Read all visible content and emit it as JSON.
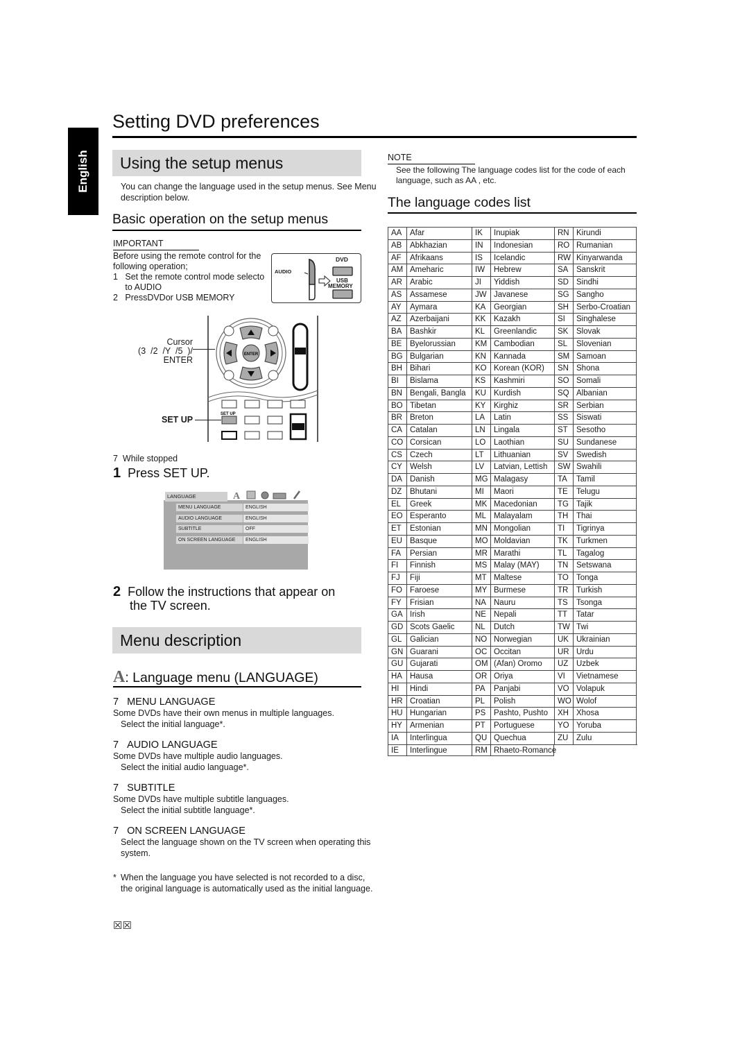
{
  "side_tab": {
    "label": "English"
  },
  "page_title": "Setting DVD preferences",
  "using_setup": {
    "heading": "Using the setup menus",
    "intro_line1": "You can change the language used in the setup menus. See  Menu",
    "intro_line2": "description  below.",
    "basic_heading": "Basic operation on the setup menus",
    "important_label": "IMPORTANT",
    "important_lines": [
      "Before using the remote control for the",
      "following operation;",
      "1   Set the remote control mode selecto",
      "     to AUDIO",
      "2   PressDVDor USB MEMORY"
    ],
    "mode_box": {
      "audio_label": "AUDIO",
      "dvd_label": "DVD",
      "usb_label_1": "USB",
      "usb_label_2": "MEMORY"
    },
    "remote": {
      "cursor_label_1": "Cursor",
      "cursor_label_2": "(3  /2  /Y  /5  )/",
      "cursor_label_3": "ENTER",
      "enter_button": "ENTER",
      "setup_button": "SET UP",
      "setup_callout": "SET UP"
    },
    "while_stopped": "7  While stopped",
    "step1": {
      "num": "1",
      "text": "Press SET UP."
    },
    "tv_screen": {
      "tab": "LANGUAGE",
      "rows": [
        {
          "key": "MENU LANGUAGE",
          "value": "ENGLISH"
        },
        {
          "key": "AUDIO LANGUAGE",
          "value": "ENGLISH"
        },
        {
          "key": "SUBTITLE",
          "value": "OFF"
        },
        {
          "key": "ON SCREEN LANGUAGE",
          "value": "ENGLISH"
        }
      ]
    },
    "step2": {
      "num": "2",
      "text_line1": "Follow the instructions that appear on",
      "text_line2": "the TV screen."
    }
  },
  "menu_description": {
    "heading": "Menu description",
    "language_menu_title": ": Language menu (LANGUAGE)",
    "items": [
      {
        "num": "7",
        "title": "MENU LANGUAGE",
        "line1": "Some DVDs have their own menus in multiple languages.",
        "line2": "Select the initial language*."
      },
      {
        "num": "7",
        "title": "AUDIO LANGUAGE",
        "line1": "Some DVDs have multiple audio languages.",
        "line2": "Select the initial audio language*."
      },
      {
        "num": "7",
        "title": "SUBTITLE",
        "line1": "Some DVDs have multiple subtitle languages.",
        "line2": "Select the initial subtitle language*."
      },
      {
        "num": "7",
        "title": "ON SCREEN LANGUAGE",
        "line1": "Select the language shown on the TV screen when operating this",
        "line2": "system."
      }
    ],
    "footnote_mark": "*",
    "footnote_line1": "When the language you have selected is not recorded to a disc,",
    "footnote_line2": "the original language is automatically used as the initial language."
  },
  "note": {
    "label": "NOTE",
    "line1": "See the following  The language codes list  for the code of each",
    "line2": "language, such as  AA , etc."
  },
  "codes": {
    "heading": "The language codes list",
    "rows": [
      [
        "AA",
        "Afar",
        "IK",
        "Inupiak",
        "RN",
        "Kirundi"
      ],
      [
        "AB",
        "Abkhazian",
        "IN",
        "Indonesian",
        "RO",
        "Rumanian"
      ],
      [
        "AF",
        "Afrikaans",
        "IS",
        "Icelandic",
        "RW",
        "Kinyarwanda"
      ],
      [
        "AM",
        "Ameharic",
        "IW",
        "Hebrew",
        "SA",
        "Sanskrit"
      ],
      [
        "AR",
        "Arabic",
        "JI",
        "Yiddish",
        "SD",
        "Sindhi"
      ],
      [
        "AS",
        "Assamese",
        "JW",
        "Javanese",
        "SG",
        "Sangho"
      ],
      [
        "AY",
        "Aymara",
        "KA",
        "Georgian",
        "SH",
        "Serbo-Croatian"
      ],
      [
        "AZ",
        "Azerbaijani",
        "KK",
        "Kazakh",
        "SI",
        "Singhalese"
      ],
      [
        "BA",
        "Bashkir",
        "KL",
        "Greenlandic",
        "SK",
        "Slovak"
      ],
      [
        "BE",
        "Byelorussian",
        "KM",
        "Cambodian",
        "SL",
        "Slovenian"
      ],
      [
        "BG",
        "Bulgarian",
        "KN",
        "Kannada",
        "SM",
        "Samoan"
      ],
      [
        "BH",
        "Bihari",
        "KO",
        "Korean (KOR)",
        "SN",
        "Shona"
      ],
      [
        "BI",
        "Bislama",
        "KS",
        "Kashmiri",
        "SO",
        "Somali"
      ],
      [
        "BN",
        "Bengali, Bangla",
        "KU",
        "Kurdish",
        "SQ",
        "Albanian"
      ],
      [
        "BO",
        "Tibetan",
        "KY",
        "Kirghiz",
        "SR",
        "Serbian"
      ],
      [
        "BR",
        "Breton",
        "LA",
        "Latin",
        "SS",
        "Siswati"
      ],
      [
        "CA",
        "Catalan",
        "LN",
        "Lingala",
        "ST",
        "Sesotho"
      ],
      [
        "CO",
        "Corsican",
        "LO",
        "Laothian",
        "SU",
        "Sundanese"
      ],
      [
        "CS",
        "Czech",
        "LT",
        "Lithuanian",
        "SV",
        "Swedish"
      ],
      [
        "CY",
        "Welsh",
        "LV",
        "Latvian, Lettish",
        "SW",
        "Swahili"
      ],
      [
        "DA",
        "Danish",
        "MG",
        "Malagasy",
        "TA",
        "Tamil"
      ],
      [
        "DZ",
        "Bhutani",
        "MI",
        "Maori",
        "TE",
        "Telugu"
      ],
      [
        "EL",
        "Greek",
        "MK",
        "Macedonian",
        "TG",
        "Tajik"
      ],
      [
        "EO",
        "Esperanto",
        "ML",
        "Malayalam",
        "TH",
        "Thai"
      ],
      [
        "ET",
        "Estonian",
        "MN",
        "Mongolian",
        "TI",
        "Tigrinya"
      ],
      [
        "EU",
        "Basque",
        "MO",
        "Moldavian",
        "TK",
        "Turkmen"
      ],
      [
        "FA",
        "Persian",
        "MR",
        "Marathi",
        "TL",
        "Tagalog"
      ],
      [
        "FI",
        "Finnish",
        "MS",
        "Malay (MAY)",
        "TN",
        "Setswana"
      ],
      [
        "FJ",
        "Fiji",
        "MT",
        "Maltese",
        "TO",
        "Tonga"
      ],
      [
        "FO",
        "Faroese",
        "MY",
        "Burmese",
        "TR",
        "Turkish"
      ],
      [
        "FY",
        "Frisian",
        "NA",
        "Nauru",
        "TS",
        "Tsonga"
      ],
      [
        "GA",
        "Irish",
        "NE",
        "Nepali",
        "TT",
        "Tatar"
      ],
      [
        "GD",
        "Scots Gaelic",
        "NL",
        "Dutch",
        "TW",
        "Twi"
      ],
      [
        "GL",
        "Galician",
        "NO",
        "Norwegian",
        "UK",
        "Ukrainian"
      ],
      [
        "GN",
        "Guarani",
        "OC",
        "Occitan",
        "UR",
        "Urdu"
      ],
      [
        "GU",
        "Gujarati",
        "OM",
        "(Afan) Oromo",
        "UZ",
        "Uzbek"
      ],
      [
        "HA",
        "Hausa",
        "OR",
        "Oriya",
        "VI",
        "Vietnamese"
      ],
      [
        "HI",
        "Hindi",
        "PA",
        "Panjabi",
        "VO",
        "Volapuk"
      ],
      [
        "HR",
        "Croatian",
        "PL",
        "Polish",
        "WO",
        "Wolof"
      ],
      [
        "HU",
        "Hungarian",
        "PS",
        "Pashto, Pushto",
        "XH",
        "Xhosa"
      ],
      [
        "HY",
        "Armenian",
        "PT",
        "Portuguese",
        "YO",
        "Yoruba"
      ],
      [
        "IA",
        "Interlingua",
        "QU",
        "Quechua",
        "ZU",
        "Zulu"
      ],
      [
        "IE",
        "Interlingue",
        "RM",
        "Rhaeto-Romance"
      ]
    ]
  },
  "page_number_glyph": "☒☒"
}
